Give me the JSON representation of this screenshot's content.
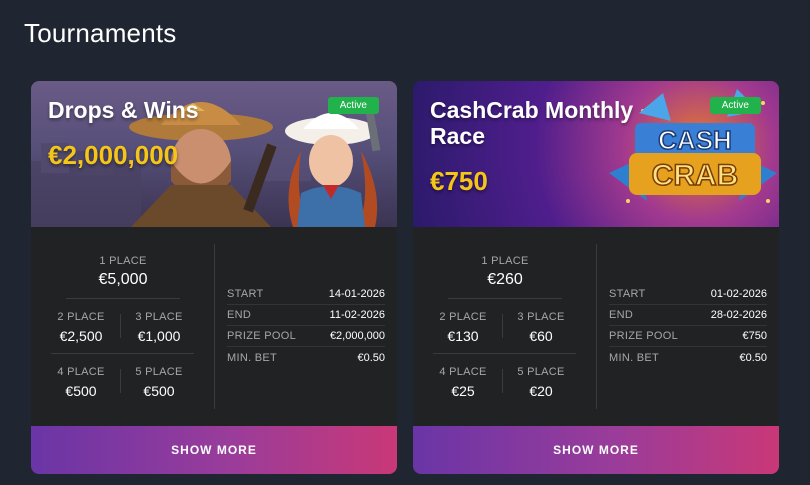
{
  "section": {
    "title": "Tournaments"
  },
  "tournaments": [
    {
      "name": "Drops & Wins",
      "prize": "€2,000,000",
      "status": "Active",
      "places": [
        {
          "label": "1 PLACE",
          "value": "€5,000"
        },
        {
          "label": "2 PLACE",
          "value": "€2,500"
        },
        {
          "label": "3 PLACE",
          "value": "€1,000"
        },
        {
          "label": "4 PLACE",
          "value": "€500"
        },
        {
          "label": "5 PLACE",
          "value": "€500"
        }
      ],
      "info": [
        {
          "key": "START",
          "value": "14-01-2026"
        },
        {
          "key": "END",
          "value": "11-02-2026"
        },
        {
          "key": "PRIZE POOL",
          "value": "€2,000,000"
        },
        {
          "key": "MIN. BET",
          "value": "€0.50"
        }
      ],
      "button": "SHOW MORE"
    },
    {
      "name": "CashCrab Monthly Race",
      "prize": "€750",
      "status": "Active",
      "logo_text": [
        "CASH",
        "CRAB"
      ],
      "places": [
        {
          "label": "1 PLACE",
          "value": "€260"
        },
        {
          "label": "2 PLACE",
          "value": "€130"
        },
        {
          "label": "3 PLACE",
          "value": "€60"
        },
        {
          "label": "4 PLACE",
          "value": "€25"
        },
        {
          "label": "5 PLACE",
          "value": "€20"
        }
      ],
      "info": [
        {
          "key": "START",
          "value": "01-02-2026"
        },
        {
          "key": "END",
          "value": "28-02-2026"
        },
        {
          "key": "PRIZE POOL",
          "value": "€750"
        },
        {
          "key": "MIN. BET",
          "value": "€0.50"
        }
      ],
      "button": "SHOW MORE"
    }
  ],
  "colors": {
    "background": "#1f2631",
    "card": "#212224",
    "badge": "#22b24c",
    "prize": "#f5c518",
    "button_gradient_start": "#6a35a6",
    "button_gradient_end": "#c93877"
  }
}
